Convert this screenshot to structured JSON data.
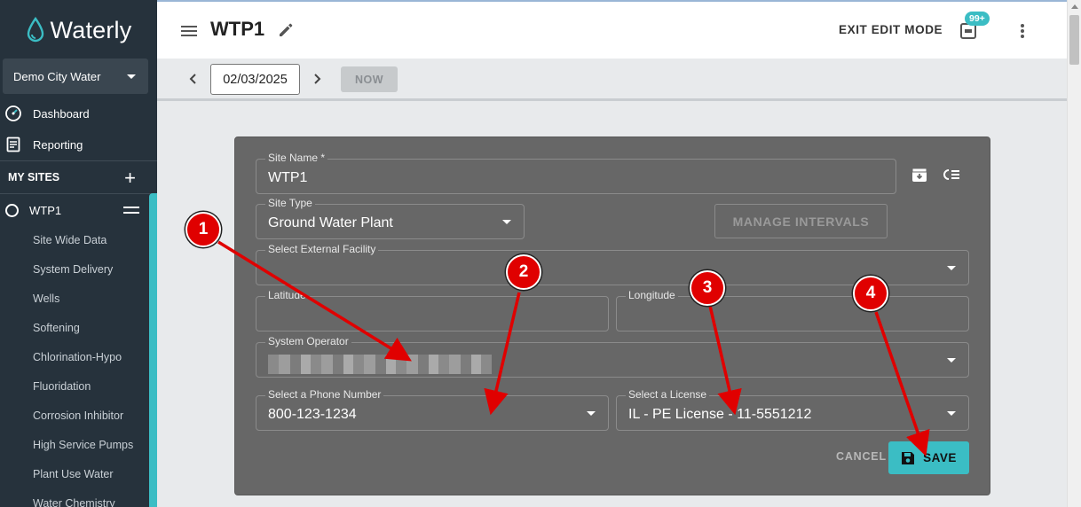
{
  "app": {
    "brand": "Waterly"
  },
  "sidebar": {
    "org": "Demo City Water",
    "nav": [
      {
        "label": "Dashboard",
        "icon": "speedometer-icon"
      },
      {
        "label": "Reporting",
        "icon": "document-icon"
      }
    ],
    "my_sites_label": "MY SITES",
    "site": "WTP1",
    "sub_items": [
      "Site Wide Data",
      "System Delivery",
      "Wells",
      "Softening",
      "Chlorination-Hypo",
      "Fluoridation",
      "Corrosion Inhibitor",
      "High Service Pumps",
      "Plant Use Water",
      "Water Chemistry"
    ]
  },
  "header": {
    "title": "WTP1",
    "exit_label": "EXIT EDIT MODE",
    "notification_count": "99+"
  },
  "toolbar": {
    "date": "02/03/2025",
    "now_label": "NOW"
  },
  "form": {
    "site_name": {
      "label": "Site Name *",
      "value": "WTP1"
    },
    "site_type": {
      "label": "Site Type",
      "value": "Ground Water Plant"
    },
    "manage_intervals_label": "MANAGE INTERVALS",
    "external_facility": {
      "label": "Select External Facility",
      "value": ""
    },
    "latitude": {
      "label": "Latitude",
      "value": ""
    },
    "longitude": {
      "label": "Longitude",
      "value": ""
    },
    "system_operator": {
      "label": "System Operator"
    },
    "phone": {
      "label": "Select a Phone Number",
      "value": "800-123-1234"
    },
    "license": {
      "label": "Select a License",
      "value": "IL - PE License - 11-5551212"
    },
    "cancel_label": "CANCEL",
    "save_label": "SAVE"
  },
  "annotations": {
    "markers": [
      "1",
      "2",
      "3",
      "4"
    ],
    "arrow_color": "#e00000"
  },
  "colors": {
    "accent": "#3bbdc4",
    "sidebar": "#26323c",
    "panel": "#676767"
  }
}
